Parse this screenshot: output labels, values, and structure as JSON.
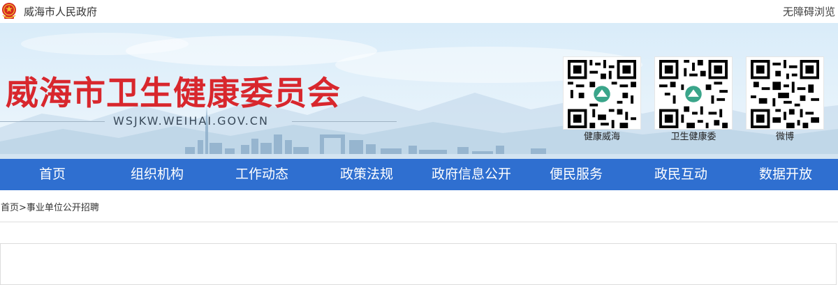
{
  "topbar": {
    "site_name": "威海市人民政府",
    "accessibility": "无障碍浏览"
  },
  "banner": {
    "title": "威海市卫生健康委员会",
    "domain": "WSJKW.WEIHAI.GOV.CN",
    "qr_codes": [
      {
        "label": "健康威海"
      },
      {
        "label": "卫生健康委"
      },
      {
        "label": "微博"
      }
    ]
  },
  "nav": {
    "items": [
      "首页",
      "组织机构",
      "工作动态",
      "政策法规",
      "政府信息公开",
      "便民服务",
      "政民互动",
      "数据开放"
    ]
  },
  "breadcrumb": {
    "home": "首页",
    "separator": ">",
    "current": "事业单位公开招聘"
  },
  "colors": {
    "title_red": "#d8272d",
    "nav_blue": "#2f6fd0",
    "banner_bg": "#e8f3fb"
  }
}
